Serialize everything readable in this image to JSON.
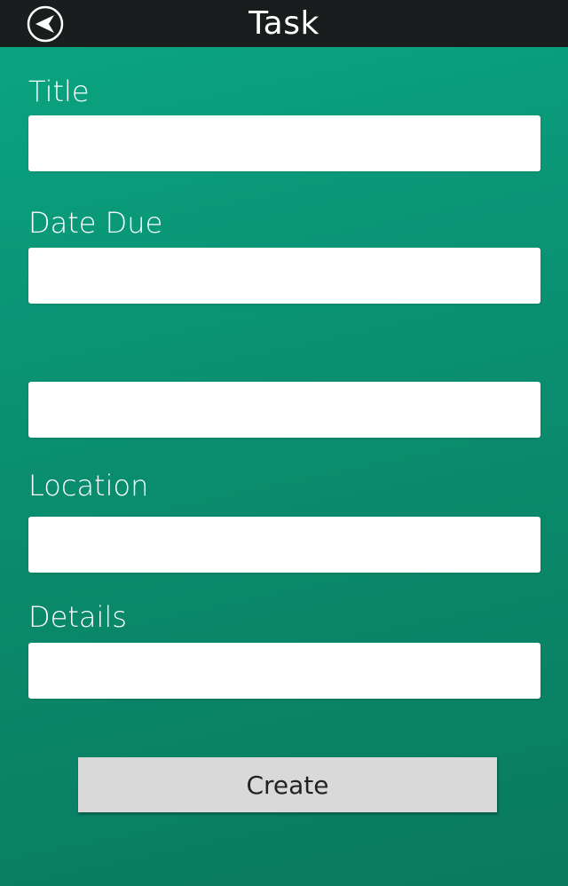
{
  "header": {
    "title": "Task",
    "back_icon": "back-arrow-circle-icon"
  },
  "form": {
    "title_label": "Title",
    "title_value": "",
    "date_due_label": "Date Due",
    "date_due_value": "",
    "unlabeled_value": "",
    "location_label": "Location",
    "location_value": "",
    "details_label": "Details",
    "details_value": ""
  },
  "actions": {
    "create_label": "Create"
  },
  "colors": {
    "topbar": "#1a1d1d",
    "background_top": "#0aa683",
    "background_bottom": "#0a7a5f",
    "input_bg": "#ffffff",
    "button_bg": "#d9d9d9"
  }
}
